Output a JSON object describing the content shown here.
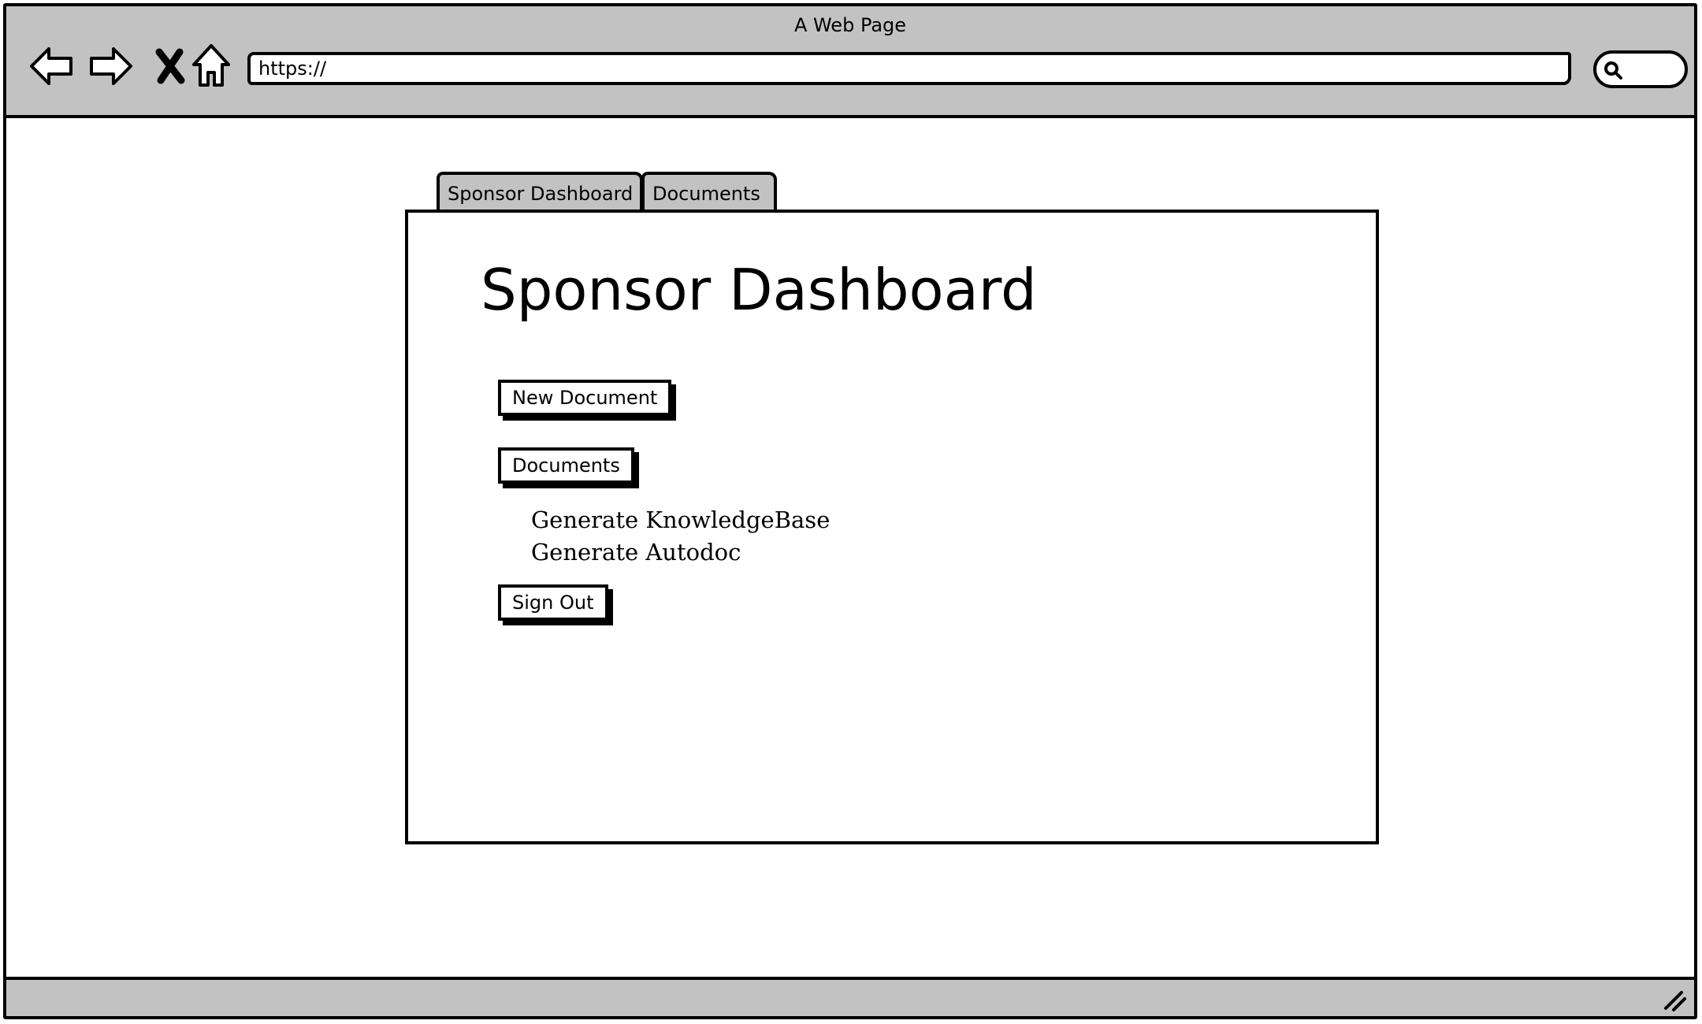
{
  "window": {
    "title": "A Web Page"
  },
  "toolbar": {
    "url": "https://",
    "icons": [
      "back-arrow-icon",
      "forward-arrow-icon",
      "close-x-icon",
      "home-icon",
      "search-icon"
    ]
  },
  "tabs": [
    {
      "label": "Sponsor Dashboard"
    },
    {
      "label": "Documents"
    }
  ],
  "main": {
    "title": "Sponsor Dashboard",
    "new_document_label": "New Document",
    "documents_label": "Documents",
    "links": [
      "Generate KnowledgeBase",
      "Generate Autodoc"
    ],
    "sign_out_label": "Sign Out"
  },
  "colors": {
    "chrome": "#c2c2c2",
    "ink": "#000000",
    "background": "#ffffff"
  }
}
